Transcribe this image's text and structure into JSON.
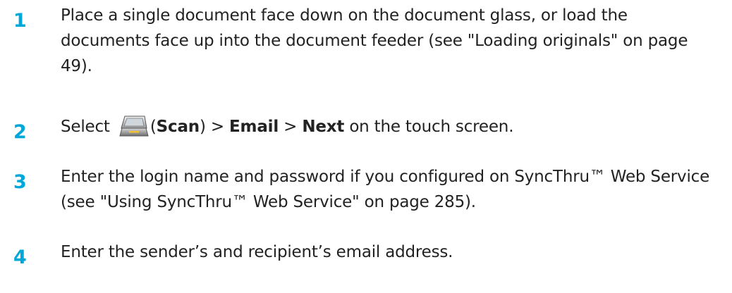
{
  "steps": [
    {
      "number": "1",
      "text": "Place a single document face down on the document glass, or load the documents face up into the document feeder (see \"Loading originals\" on page 49)."
    },
    {
      "number": "2",
      "before_icon": "Select",
      "icon": "scanner-icon",
      "open_paren": "(",
      "scan_label": "Scan",
      "sep1": ") > ",
      "email_label": "Email",
      "sep2": " > ",
      "next_label": "Next",
      "after": " on the touch screen."
    },
    {
      "number": "3",
      "text": "Enter the login name and password if you configured on SyncThru™ Web Service (see \"Using SyncThru™ Web Service\" on page 285)."
    },
    {
      "number": "4",
      "text": "Enter the sender’s and recipient’s email address."
    }
  ],
  "colors": {
    "step_number": "#00a7d8",
    "body_text": "#222222"
  }
}
